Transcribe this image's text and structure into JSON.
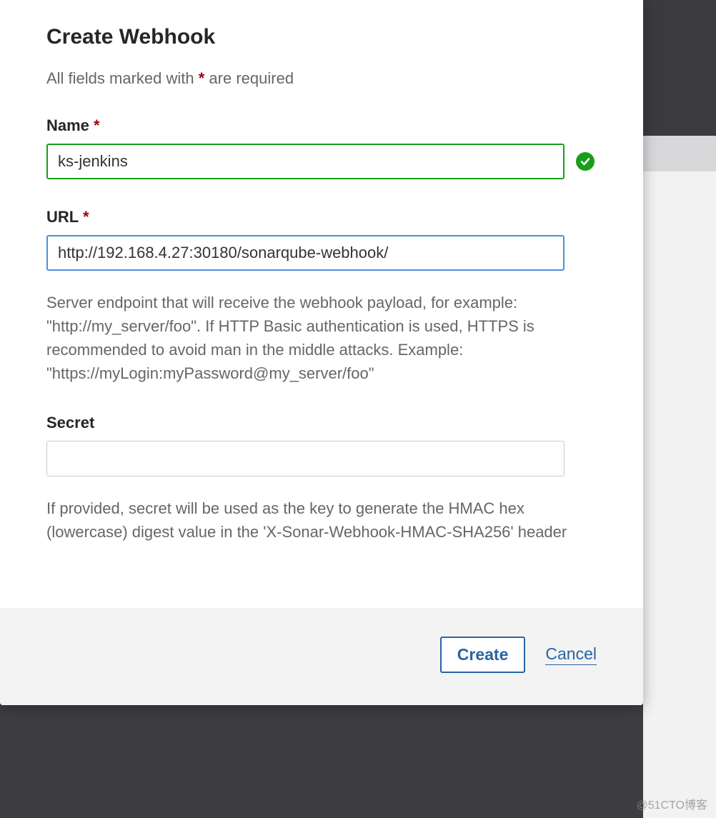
{
  "modal": {
    "title": "Create Webhook",
    "subtitle_prefix": "All fields marked with ",
    "subtitle_suffix": " are required",
    "asterisk": "*"
  },
  "fields": {
    "name": {
      "label": "Name",
      "value": "ks-jenkins"
    },
    "url": {
      "label": "URL",
      "value": "http://192.168.4.27:30180/sonarqube-webhook/",
      "help": "Server endpoint that will receive the webhook payload, for example: \"http://my_server/foo\". If HTTP Basic authentication is used, HTTPS is recommended to avoid man in the middle attacks. Example: \"https://myLogin:myPassword@my_server/foo\""
    },
    "secret": {
      "label": "Secret",
      "value": "",
      "help": "If provided, secret will be used as the key to generate the HMAC hex (lowercase) digest value in the 'X-Sonar-Webhook-HMAC-SHA256' header"
    }
  },
  "actions": {
    "create": "Create",
    "cancel": "Cancel"
  },
  "watermark": "@51CTO博客"
}
